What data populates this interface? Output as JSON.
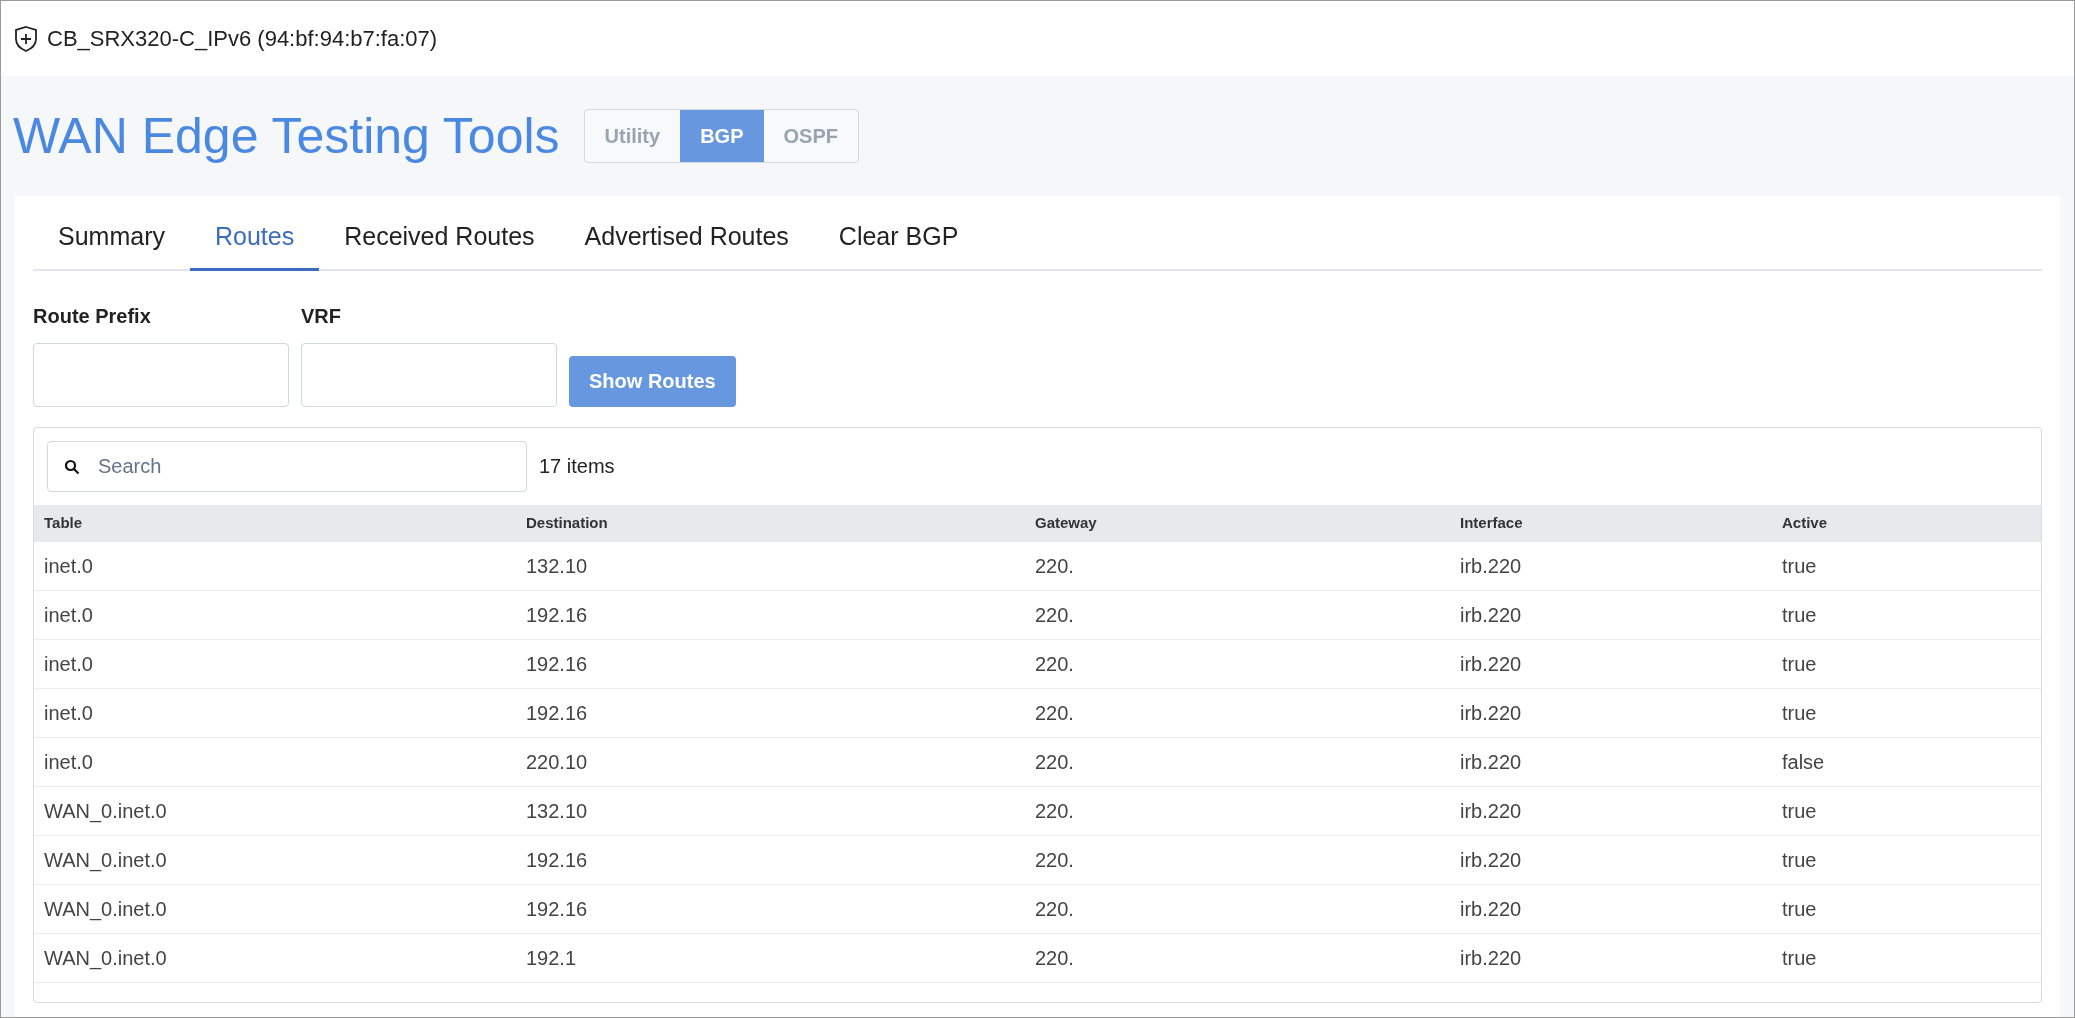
{
  "window": {
    "title": "CB_SRX320-C_IPv6 (94:bf:94:b7:fa:07)"
  },
  "header": {
    "title": "WAN Edge Testing Tools",
    "modes": [
      {
        "label": "Utility",
        "selected": false
      },
      {
        "label": "BGP",
        "selected": true
      },
      {
        "label": "OSPF",
        "selected": false
      }
    ]
  },
  "tabs": [
    {
      "label": "Summary",
      "selected": false
    },
    {
      "label": "Routes",
      "selected": true
    },
    {
      "label": "Received Routes",
      "selected": false
    },
    {
      "label": "Advertised Routes",
      "selected": false
    },
    {
      "label": "Clear BGP",
      "selected": false
    }
  ],
  "form": {
    "fields": [
      {
        "label": "Route Prefix"
      },
      {
        "label": "VRF"
      }
    ],
    "button": "Show Routes"
  },
  "table": {
    "search": {
      "placeholder": "Search"
    },
    "count": "17 items",
    "columns": [
      "Table",
      "Destination",
      "Gateway",
      "Interface",
      "Active"
    ],
    "rows": [
      [
        "inet.0",
        "132.10",
        "220.",
        "irb.220",
        "true"
      ],
      [
        "inet.0",
        "192.16",
        "220.",
        "irb.220",
        "true"
      ],
      [
        "inet.0",
        "192.16",
        "220.",
        "irb.220",
        "true"
      ],
      [
        "inet.0",
        "192.16",
        "220.",
        "irb.220",
        "true"
      ],
      [
        "inet.0",
        "220.10",
        "220.",
        "irb.220",
        "false"
      ],
      [
        "WAN_0.inet.0",
        "132.10",
        "220.",
        "irb.220",
        "true"
      ],
      [
        "WAN_0.inet.0",
        "192.16",
        "220.",
        "irb.220",
        "true"
      ],
      [
        "WAN_0.inet.0",
        "192.16",
        "220.",
        "irb.220",
        "true"
      ],
      [
        "WAN_0.inet.0",
        "192.1",
        "220.",
        "irb.220",
        "true"
      ]
    ]
  }
}
